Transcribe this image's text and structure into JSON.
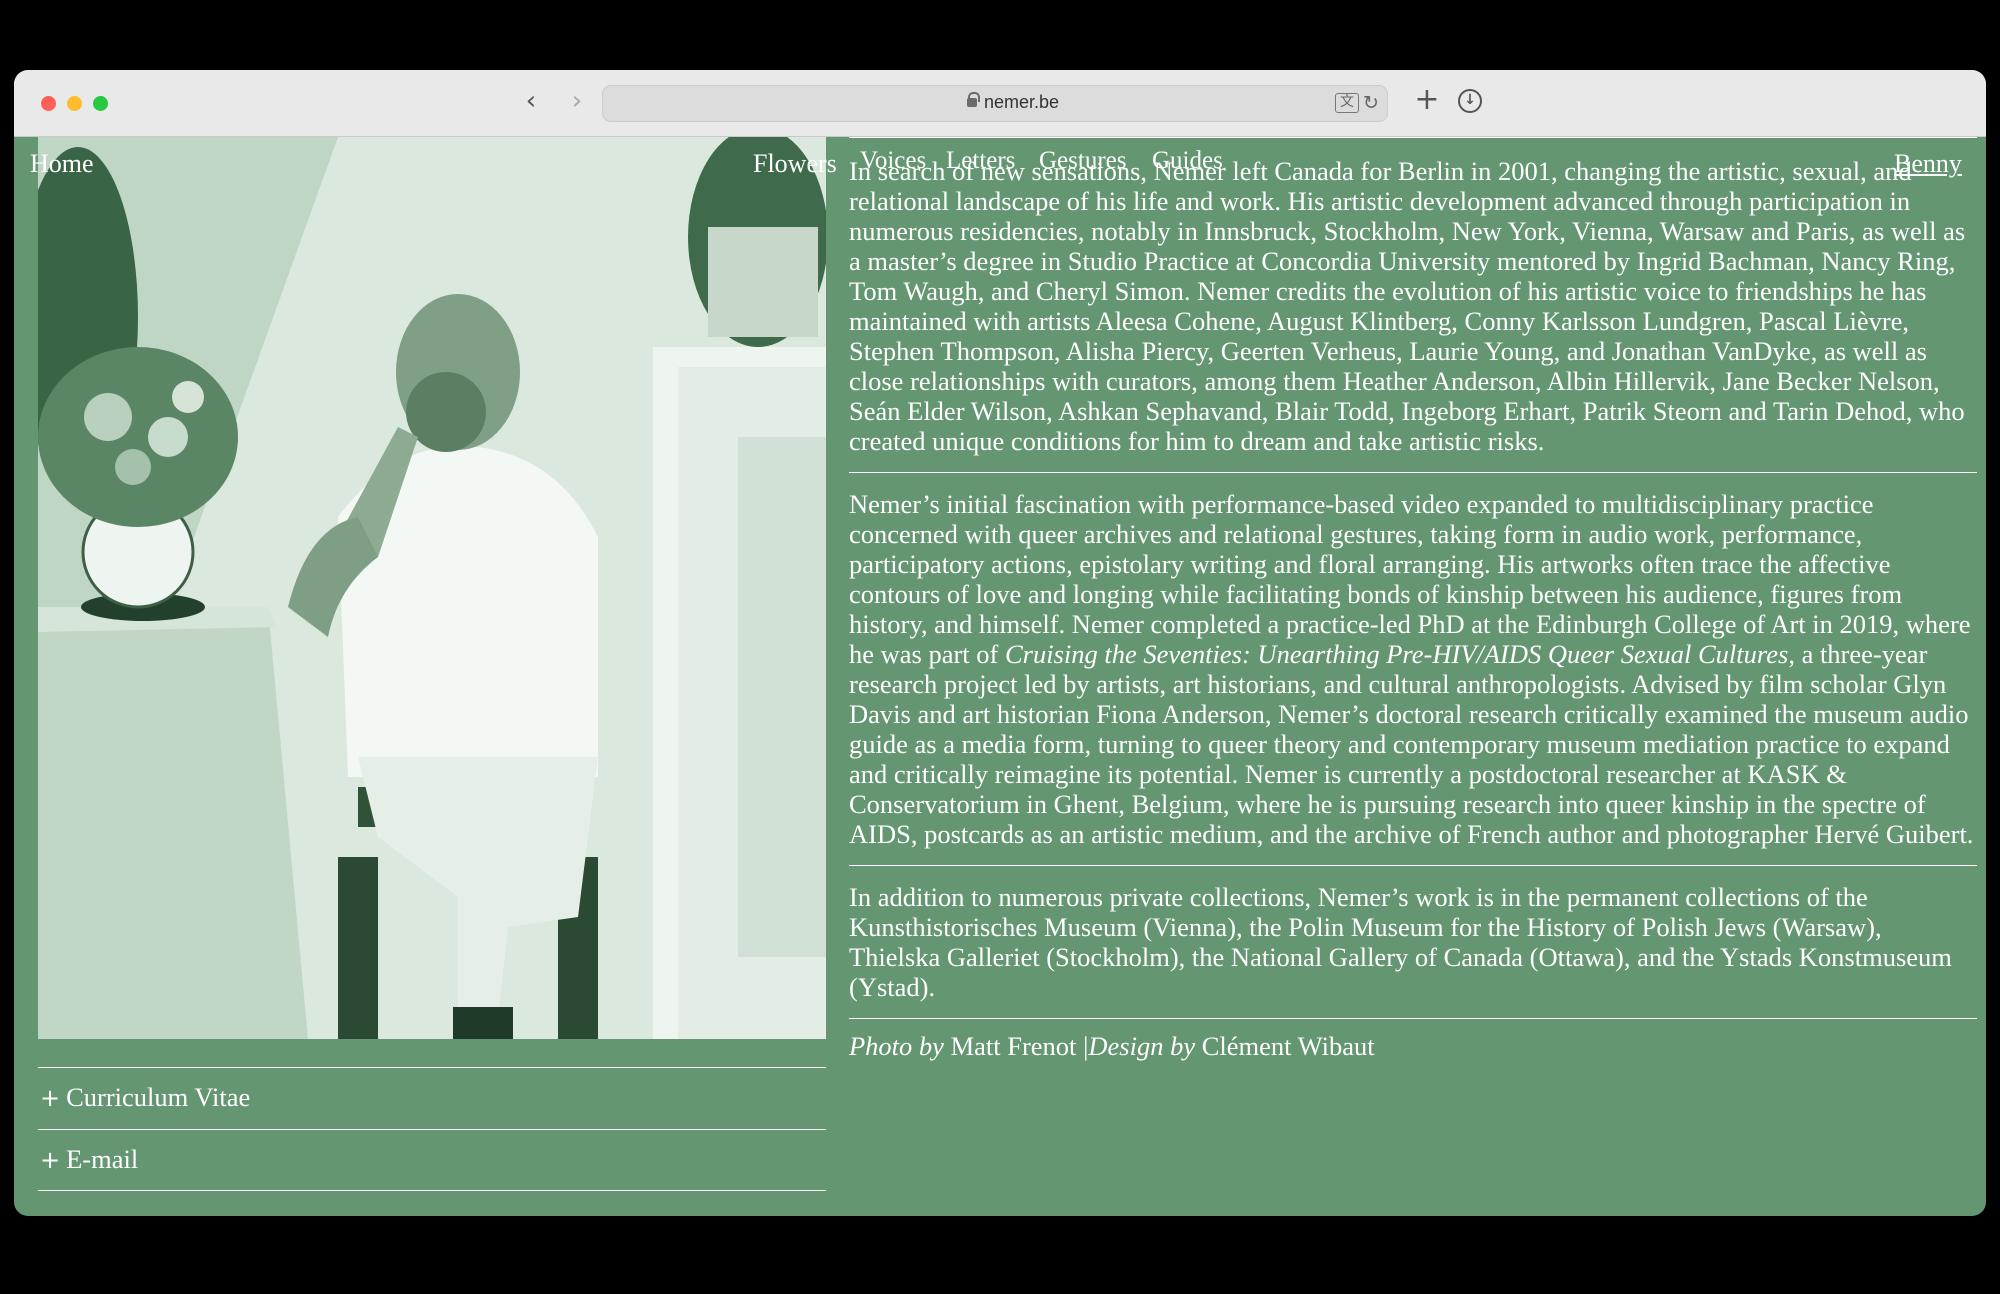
{
  "browser": {
    "url": "nemer.be",
    "icons": {
      "back": "chevron-left-icon",
      "forward": "chevron-right-icon",
      "lock": "lock-icon",
      "translate": "translate-icon",
      "reload": "reload-icon",
      "new_tab": "plus-icon",
      "downloads": "download-icon"
    },
    "traffic_colors": [
      "#fe5f57",
      "#febc2e",
      "#28c840"
    ]
  },
  "nav": {
    "home": "Home",
    "flowers": "Flowers",
    "voices": "Voices",
    "letters": "Letters",
    "gestures": "Gestures",
    "guides": "Guides",
    "benny": "Benny"
  },
  "bio": {
    "para1": "In search of new sensations, Nemer left Canada for Berlin in 2001, changing the artistic, sexual, and relational landscape of his life and work. His artistic development advanced through participation in numerous residencies, notably in Innsbruck, Stockholm, New York, Vienna, Warsaw and Paris, as well as a master’s degree in Studio Practice at Concordia University mentored by Ingrid Bachman, Nancy Ring, Tom Waugh, and Cheryl Simon. Nemer credits the evolution of his artistic voice to friendships he has maintained with artists Aleesa Cohene, August Klintberg, Conny Karlsson Lundgren, Pascal Lièvre, Stephen Thompson, Alisha Piercy, Geerten Verheus, Laurie Young, and Jonathan VanDyke, as well as close relationships with curators, among them Heather Anderson, Albin Hillervik, Jane Becker Nelson, Seán Elder Wilson, Ashkan Sephavand, Blair Todd, Ingeborg Erhart, Patrik Steorn and Tarin Dehod, who created unique conditions for him to dream and take artistic risks.",
    "para2_a": "Nemer’s initial fascination with performance-based video expanded to multidisciplinary practice concerned with queer archives and relational gestures, taking form in audio work, performance, participatory actions, epistolary writing and floral arranging. His artworks often trace the affective contours of love and longing while facilitating bonds of kinship between his audience, figures from history, and himself. Nemer completed a practice-led PhD at the Edinburgh College of Art in 2019, where he was part of ",
    "para2_em": "Cruising the Seventies: Unearthing Pre-HIV/AIDS Queer Sexual Cultures",
    "para2_b": ", a three-year research project led by artists, art historians, and cultural anthropologists. Advised by film scholar Glyn Davis and art historian Fiona Anderson, Nemer’s doctoral research critically examined the museum audio guide as a media form, turning to queer theory and contemporary museum mediation practice to expand and critically reimagine its potential. Nemer is currently a postdoctoral researcher at KASK & Conservatorium in Ghent, Belgium, where he is pursuing research into queer kinship in the spectre of AIDS, postcards as an artistic medium, and the archive of French author and photographer Hervé Guibert.",
    "para3": "In addition to numerous private collections, Nemer’s work is in the permanent collections of the Kunsthistorisches Museum (Vienna), the Polin Museum for the History of Polish Jews (Warsaw), Thielska Galleriet  (Stockholm), the National Gallery of Canada (Ottawa), and the Ystads Konstmuseum (Ystad)."
  },
  "credits": {
    "photo_label": "Photo by",
    "photo_name": "Matt Frenot",
    "separator": "|",
    "design_label": "Design by",
    "design_name": "Clément Wibaut"
  },
  "accordion": {
    "cv": "Curriculum Vitae",
    "email": "E-mail",
    "plus": "+"
  },
  "theme": {
    "background": "#649672",
    "text": "#ffffff"
  }
}
